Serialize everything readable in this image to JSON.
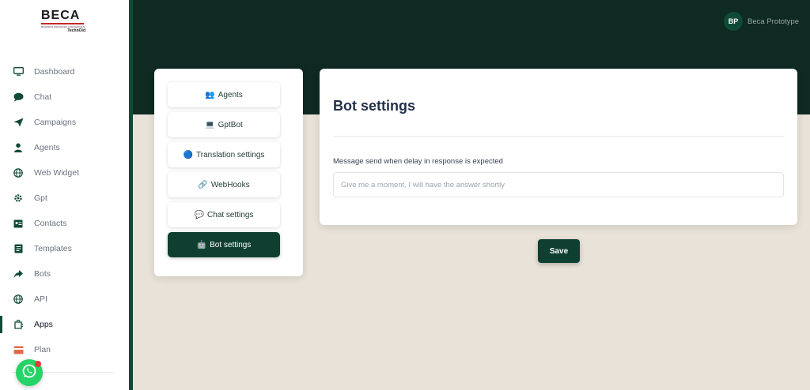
{
  "brand": {
    "word": "BECA",
    "tagline": "BUSINESS ENHANCED CONCIERGE AI",
    "by": "TechnOid"
  },
  "sidebar": {
    "items": [
      {
        "label": "Dashboard",
        "icon": "monitor-icon"
      },
      {
        "label": "Chat",
        "icon": "chat-bubble-icon"
      },
      {
        "label": "Campaigns",
        "icon": "paper-plane-icon"
      },
      {
        "label": "Agents",
        "icon": "user-icon"
      },
      {
        "label": "Web Widget",
        "icon": "globe-icon"
      },
      {
        "label": "Gpt",
        "icon": "gear-icon"
      },
      {
        "label": "Contacts",
        "icon": "contact-card-icon"
      },
      {
        "label": "Templates",
        "icon": "document-icon"
      },
      {
        "label": "Bots",
        "icon": "share-arrow-icon"
      },
      {
        "label": "API",
        "icon": "globe-icon"
      },
      {
        "label": "Apps",
        "icon": "puzzle-icon",
        "active": true
      },
      {
        "label": "Plan",
        "icon": "credit-card-icon"
      }
    ]
  },
  "profile": {
    "initials": "BP",
    "name": "Beca Prototype"
  },
  "settings_menu": {
    "items": [
      {
        "label": "Agents",
        "icon": "👥"
      },
      {
        "label": "GptBot",
        "icon": "💻"
      },
      {
        "label": "Translation settings",
        "icon": "🔵"
      },
      {
        "label": "WebHooks",
        "icon": "🔗"
      },
      {
        "label": "Chat settings",
        "icon": "💬"
      },
      {
        "label": "Bot settings",
        "icon": "🤖",
        "active": true
      }
    ]
  },
  "panel": {
    "title": "Bot settings",
    "field_label": "Message send when delay in response is expected",
    "field_placeholder": "Give me a moment, I will have the answer shortly",
    "field_value": ""
  },
  "actions": {
    "save_label": "Save"
  },
  "colors": {
    "primary": "#0e3f31",
    "header": "#0e2a22",
    "background": "#e8e2d8",
    "whatsapp": "#25d366"
  }
}
